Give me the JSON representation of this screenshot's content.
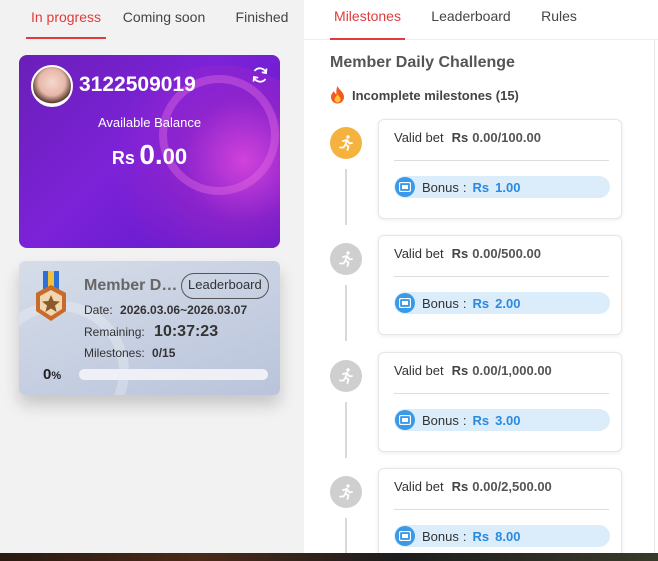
{
  "left_tabs": [
    {
      "label": "In progress",
      "active": true
    },
    {
      "label": "Coming soon",
      "active": false
    },
    {
      "label": "Finished",
      "active": false
    }
  ],
  "user_card": {
    "user_id": "3122509019",
    "balance_label": "Available Balance",
    "currency": "Rs",
    "balance_int": "0.",
    "balance_dec": "00"
  },
  "event_card": {
    "title": "Member D…",
    "leaderboard_label": "Leaderboard",
    "date_label": "Date:",
    "date_value": "2026.03.06~2026.03.07",
    "remaining_label": "Remaining:",
    "remaining_value": "10:37:23",
    "milestones_label": "Milestones:",
    "milestones_value": "0/15",
    "progress_value": "0",
    "progress_unit": "%",
    "progress_fraction": 0
  },
  "right_tabs": [
    {
      "label": "Milestones",
      "active": true
    },
    {
      "label": "Leaderboard",
      "active": false
    },
    {
      "label": "Rules",
      "active": false
    }
  ],
  "challenge": {
    "title": "Member Daily Challenge",
    "incomplete_label": "Incomplete milestones (15)"
  },
  "milestones": [
    {
      "label": "Valid bet",
      "currency": "Rs",
      "value": "0.00/100.00",
      "bonus_label": "Bonus",
      "bonus_colon": ":",
      "bonus_currency": "Rs",
      "bonus_value": "1.00",
      "active": true
    },
    {
      "label": "Valid bet",
      "currency": "Rs",
      "value": "0.00/500.00",
      "bonus_label": "Bonus",
      "bonus_colon": ":",
      "bonus_currency": "Rs",
      "bonus_value": "2.00",
      "active": false
    },
    {
      "label": "Valid bet",
      "currency": "Rs",
      "value": "0.00/1,000.00",
      "bonus_label": "Bonus",
      "bonus_colon": ":",
      "bonus_currency": "Rs",
      "bonus_value": "3.00",
      "active": false
    },
    {
      "label": "Valid bet",
      "currency": "Rs",
      "value": "0.00/2,500.00",
      "bonus_label": "Bonus",
      "bonus_colon": ":",
      "bonus_currency": "Rs",
      "bonus_value": "8.00",
      "active": false
    }
  ],
  "colors": {
    "accent": "#e23b3b",
    "active_milestone": "#f6b23e",
    "inactive_milestone": "#cfcfcf",
    "bonus_bg": "#dbecfb",
    "bonus_text": "#2b8ae0",
    "card_purple": "#7c22d8"
  },
  "icons": {
    "refresh": "refresh-icon",
    "fire": "fire-icon",
    "runner": "runner-icon",
    "bonus": "bonus-wallet-icon",
    "medal": "medal-icon"
  }
}
